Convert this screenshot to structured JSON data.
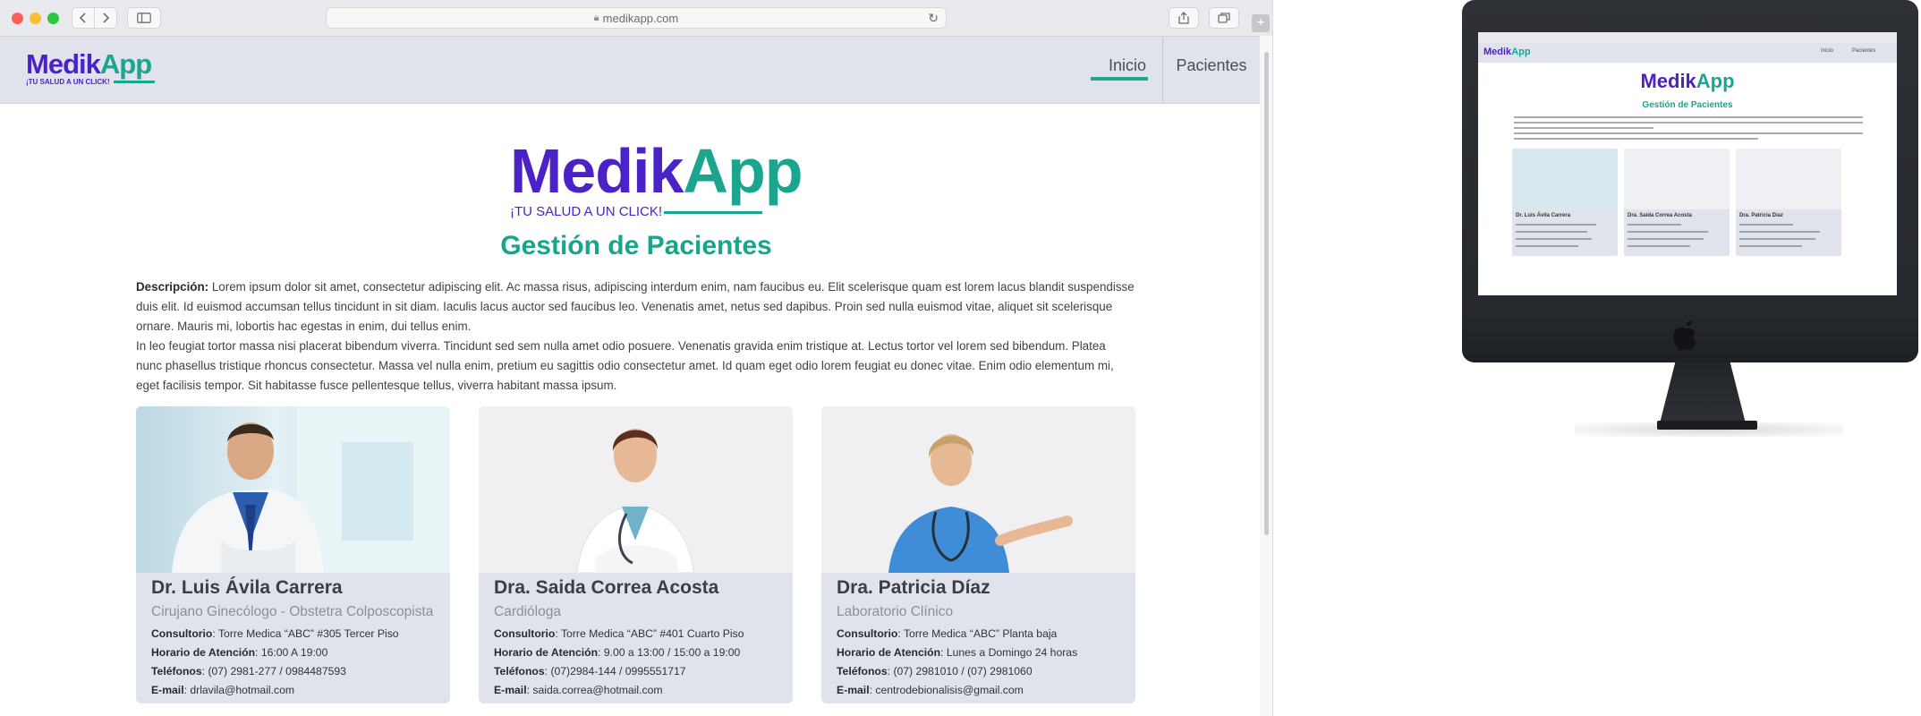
{
  "browser": {
    "url": "medikapp.com",
    "back_icon": "chevron-left-icon",
    "forward_icon": "chevron-right-icon",
    "sidebar_icon": "sidebar-icon",
    "share_icon": "share-icon",
    "tabs_icon": "tabs-icon",
    "reload_icon": "reload-icon",
    "new_tab_label": "+"
  },
  "brand": {
    "name_part1": "Me",
    "name_part2": "dik",
    "name_part3": "App",
    "tagline": "¡TU SALUD A UN CLICK!",
    "colors": {
      "purple": "#4b22c8",
      "teal": "#1ba58f"
    }
  },
  "nav": {
    "items": [
      {
        "label": "Inicio",
        "active": true
      },
      {
        "label": "Pacientes",
        "active": false
      }
    ]
  },
  "main": {
    "title": "Gestión de Pacientes",
    "description_label": "Descripción:",
    "description_p1": "Lorem ipsum dolor sit amet, consectetur adipiscing elit. Ac massa risus, adipiscing interdum enim, nam faucibus eu. Elit scelerisque quam est lorem lacus blandit suspendisse duis elit. Id euismod accumsan tellus tincidunt in sit diam. Iaculis lacus auctor sed faucibus leo. Venenatis amet, netus sed dapibus. Proin sed nulla euismod vitae, aliquet sit scelerisque ornare. Mauris mi, lobortis hac egestas in enim, dui tellus enim.",
    "description_p2": "In leo feugiat tortor massa nisi placerat bibendum viverra. Tincidunt sed sem nulla amet odio posuere. Venenatis gravida enim tristique at. Lectus tortor vel lorem sed bibendum. Platea nunc phasellus tristique rhoncus consectetur. Massa vel nulla enim, pretium eu sagittis odio consectetur amet. Id quam eget odio lorem feugiat eu donec vitae. Enim odio elementum mi, eget facilisis tempor. Sit habitasse fusce pellentesque tellus, viverra habitant massa ipsum."
  },
  "labels": {
    "consultorio": "Consultorio",
    "horario": "Horario de Atención",
    "telefonos": "Teléfonos",
    "email": "E-mail"
  },
  "doctors": [
    {
      "name": "Dr. Luis Ávila Carrera",
      "specialty": "Cirujano Ginecólogo - Obstetra Colposcopista",
      "consultorio": "Torre Medica “ABC” #305 Tercer Piso",
      "horario": "16:00 A 19:00",
      "telefonos": "(07) 2981-277 / 0984487593",
      "email": "drlavila@hotmail.com"
    },
    {
      "name": "Dra. Saida Correa Acosta",
      "specialty": "Cardióloga",
      "consultorio": "Torre Medica “ABC” #401 Cuarto Piso",
      "horario": "9.00 a 13:00 / 15:00 a 19:00",
      "telefonos": "(07)2984-144 / 0995551717",
      "email": "saida.correa@hotmail.com"
    },
    {
      "name": "Dra. Patricia Díaz",
      "specialty": "Laboratorio Clínico",
      "consultorio": "Torre Medica “ABC” Planta baja",
      "horario": "Lunes a Domingo 24 horas",
      "telefonos": "(07) 2981010 / (07) 2981060",
      "email": "centrodebionalisis@gmail.com"
    }
  ],
  "mockup": {
    "nav1": "Inicio",
    "nav2": "Pacientes",
    "apple_icon": "apple-logo-icon"
  }
}
